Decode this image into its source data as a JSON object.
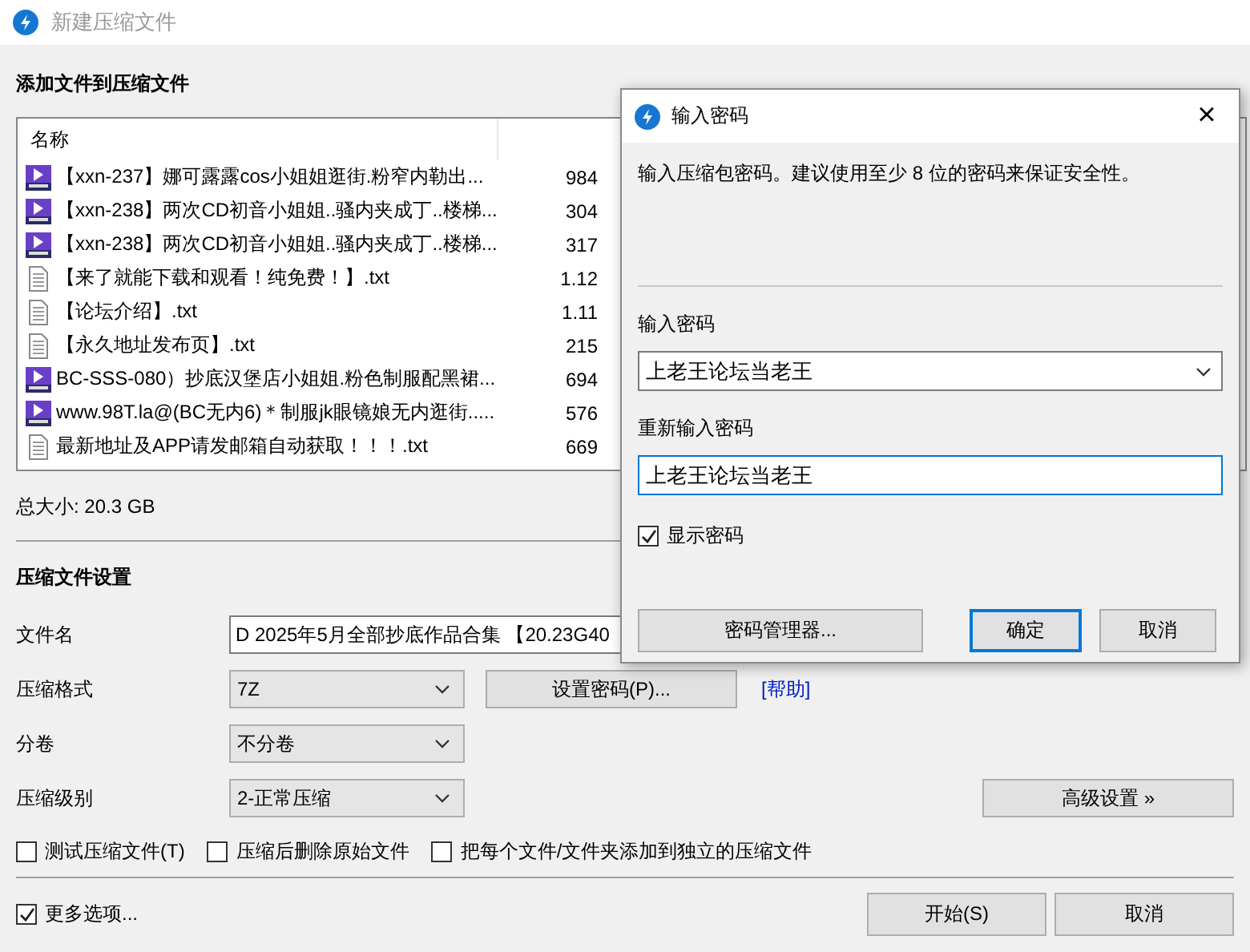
{
  "window": {
    "title": "新建压缩文件"
  },
  "files": {
    "heading": "添加文件到压缩文件",
    "columns": [
      "名称"
    ],
    "rows": [
      {
        "kind": "video",
        "name": "【xxn-237】娜可露露cos小姐姐逛街.粉窄内勒出...",
        "size": "984"
      },
      {
        "kind": "video",
        "name": "【xxn-238】两次CD初音小姐姐..骚内夹成丁..楼梯...",
        "size": "304"
      },
      {
        "kind": "video",
        "name": "【xxn-238】两次CD初音小姐姐..骚内夹成丁..楼梯...",
        "size": "317"
      },
      {
        "kind": "text",
        "name": "【来了就能下载和观看！纯免费！】.txt",
        "size": "1.12"
      },
      {
        "kind": "text",
        "name": "【论坛介绍】.txt",
        "size": "1.11"
      },
      {
        "kind": "text",
        "name": "【永久地址发布页】.txt",
        "size": "215"
      },
      {
        "kind": "video",
        "name": "BC-SSS-080）抄底汉堡店小姐姐.粉色制服配黑裙...",
        "size": "694"
      },
      {
        "kind": "video",
        "name": "www.98T.la@(BC无内6)＊制服jk眼镜娘无内逛街.....",
        "size": "576"
      },
      {
        "kind": "text",
        "name": "最新地址及APP请发邮箱自动获取！！！.txt",
        "size": "669"
      }
    ]
  },
  "total_size": "总大小: 20.3 GB",
  "settings": {
    "heading": "压缩文件设置",
    "filename": {
      "label": "文件名",
      "value": "D 2025年5月全部抄底作品合集 【20.23G40"
    },
    "format": {
      "label": "压缩格式",
      "value": "7Z"
    },
    "set_password_button": "设置密码(P)...",
    "help_link": "[帮助]",
    "split": {
      "label": "分卷",
      "value": "不分卷"
    },
    "level": {
      "label": "压缩级别",
      "value": "2-正常压缩"
    },
    "advanced_button": "高级设置 »",
    "options": [
      {
        "label": "测试压缩文件(T)",
        "checked": false
      },
      {
        "label": "压缩后删除原始文件",
        "checked": false
      },
      {
        "label": "把每个文件/文件夹添加到独立的压缩文件",
        "checked": false
      }
    ]
  },
  "more_options": {
    "label": "更多选项...",
    "checked": true
  },
  "buttons": [
    "开始(S)",
    "取消"
  ],
  "dialog": {
    "title": "输入密码",
    "close": "×",
    "hint": "输入压缩包密码。建议使用至少 8 位的密码来保证安全性。",
    "password": {
      "label": "输入密码",
      "value": "上老王论坛当老王"
    },
    "confirm": {
      "label": "重新输入密码",
      "value": "上老王论坛当老王"
    },
    "show_password": {
      "label": "显示密码",
      "checked": true
    },
    "buttons": [
      "密码管理器...",
      "确定",
      "取消"
    ]
  }
}
